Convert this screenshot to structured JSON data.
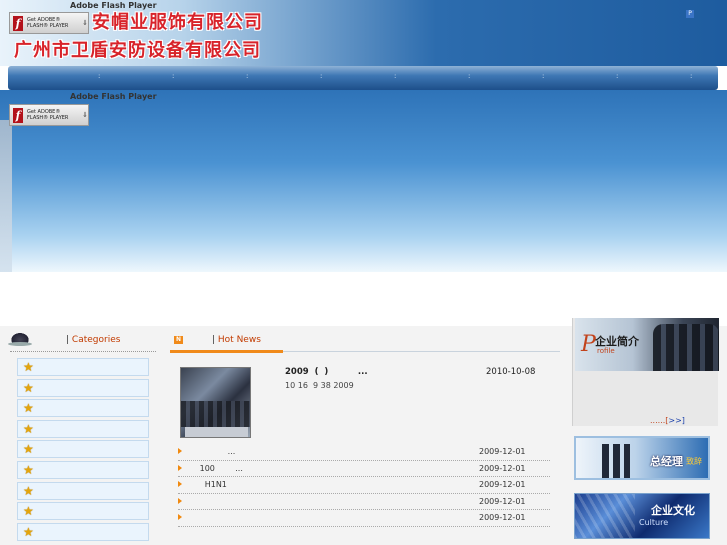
{
  "header": {
    "company_line1": "安帽业服饰有限公司",
    "company_line2": "广州市卫盾安防设备有限公司",
    "flash_label": "Adobe Flash Player",
    "flash_button_text": "Get ADOBE® FLASH® PLAYER"
  },
  "nav": {
    "items": [
      ":",
      ":",
      ":",
      ":",
      ":",
      ":",
      ":",
      ":",
      ":"
    ]
  },
  "banner": {
    "flash_label": "Adobe Flash Player",
    "flash_button_text": "Get ADOBE® FLASH® PLAYER"
  },
  "categories": {
    "heading": "Categories",
    "items": [
      "",
      "",
      "",
      "",
      "",
      "",
      "",
      "",
      ""
    ]
  },
  "news": {
    "heading": "Hot News",
    "feature": {
      "title": "2009  (  )          ...",
      "date": "2010-10-08",
      "desc": "10 16  9 38 2009"
    },
    "items": [
      {
        "title": "              ...",
        "date": "2009-12-01"
      },
      {
        "title": "   100        ...",
        "date": "2009-12-01"
      },
      {
        "title": "     H1N1",
        "date": "2009-12-01"
      },
      {
        "title": "",
        "date": "2009-12-01"
      },
      {
        "title": "",
        "date": "2009-12-01"
      }
    ]
  },
  "sidebar": {
    "profile_p": "P",
    "profile_cn": "企业简介",
    "profile_en": "rofile",
    "more_prefix": "......[",
    "more_link": ">>]",
    "gm_title": "总经理",
    "gm_sub": "致辞",
    "culture_title": "企业文化",
    "culture_sub": "Culture"
  }
}
